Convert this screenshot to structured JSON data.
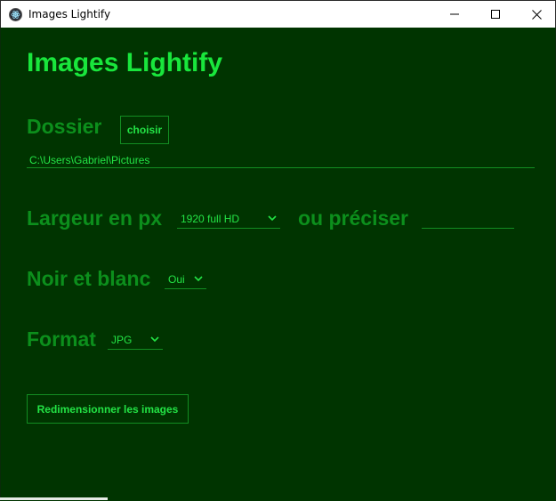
{
  "window": {
    "title": "Images Lightify"
  },
  "app": {
    "title": "Images Lightify"
  },
  "folder": {
    "label": "Dossier",
    "choose_button": "choisir",
    "path": "C:\\Users\\Gabriel\\Pictures"
  },
  "width": {
    "label": "Largeur en px",
    "selected": "1920 full HD",
    "or_specify_label": "ou préciser",
    "custom_value": ""
  },
  "grayscale": {
    "label": "Noir et blanc",
    "selected": "Oui"
  },
  "format": {
    "label": "Format",
    "selected": "JPG"
  },
  "resize_button": "Redimensionner les images",
  "colors": {
    "background": "#003400",
    "title": "#19e63c",
    "label": "#0c8f1c",
    "accent": "#23e345",
    "border": "#138d22"
  }
}
